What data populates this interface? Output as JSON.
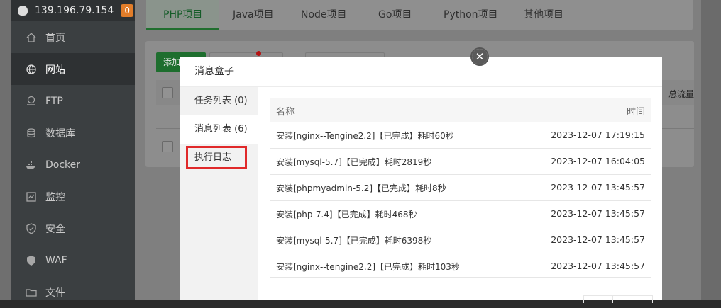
{
  "server": {
    "ip": "139.196.79.154",
    "badge": "0"
  },
  "sidebar": {
    "items": [
      {
        "label": "首页",
        "icon": "home-icon"
      },
      {
        "label": "网站",
        "icon": "globe-icon"
      },
      {
        "label": "FTP",
        "icon": "ftp-icon"
      },
      {
        "label": "数据库",
        "icon": "database-icon"
      },
      {
        "label": "Docker",
        "icon": "docker-icon"
      },
      {
        "label": "监控",
        "icon": "monitor-icon"
      },
      {
        "label": "安全",
        "icon": "shield-icon"
      },
      {
        "label": "WAF",
        "icon": "waf-shield-icon"
      },
      {
        "label": "文件",
        "icon": "folder-icon"
      }
    ]
  },
  "tabs": [
    {
      "label": "PHP项目"
    },
    {
      "label": "Java项目"
    },
    {
      "label": "Node项目"
    },
    {
      "label": "Go项目"
    },
    {
      "label": "Python项目"
    },
    {
      "label": "其他项目"
    }
  ],
  "toolbar": {
    "add_label": "添加"
  },
  "table": {
    "traffic_header": "总流量"
  },
  "modal": {
    "title": "消息盒子",
    "nav": [
      {
        "label": "任务列表 (0)"
      },
      {
        "label": "消息列表 (6)"
      },
      {
        "label": "执行日志"
      }
    ],
    "columns": {
      "name": "名称",
      "time": "时间"
    },
    "rows": [
      {
        "name": "安装[nginx--Tengine2.2]【已完成】耗时60秒",
        "time": "2023-12-07 17:19:15"
      },
      {
        "name": "安装[mysql-5.7]【已完成】耗时2819秒",
        "time": "2023-12-07 16:04:05"
      },
      {
        "name": "安装[phpmyadmin-5.2]【已完成】耗时8秒",
        "time": "2023-12-07 13:45:57"
      },
      {
        "name": "安装[php-7.4]【已完成】耗时468秒",
        "time": "2023-12-07 13:45:57"
      },
      {
        "name": "安装[mysql-5.7]【已完成】耗时6398秒",
        "time": "2023-12-07 13:45:57"
      },
      {
        "name": "安装[nginx--tengine2.2]【已完成】耗时103秒",
        "time": "2023-12-07 13:45:57"
      }
    ]
  },
  "colors": {
    "accent": "#20a53a",
    "highlight": "#e0292a",
    "badge": "#e27d2a"
  }
}
